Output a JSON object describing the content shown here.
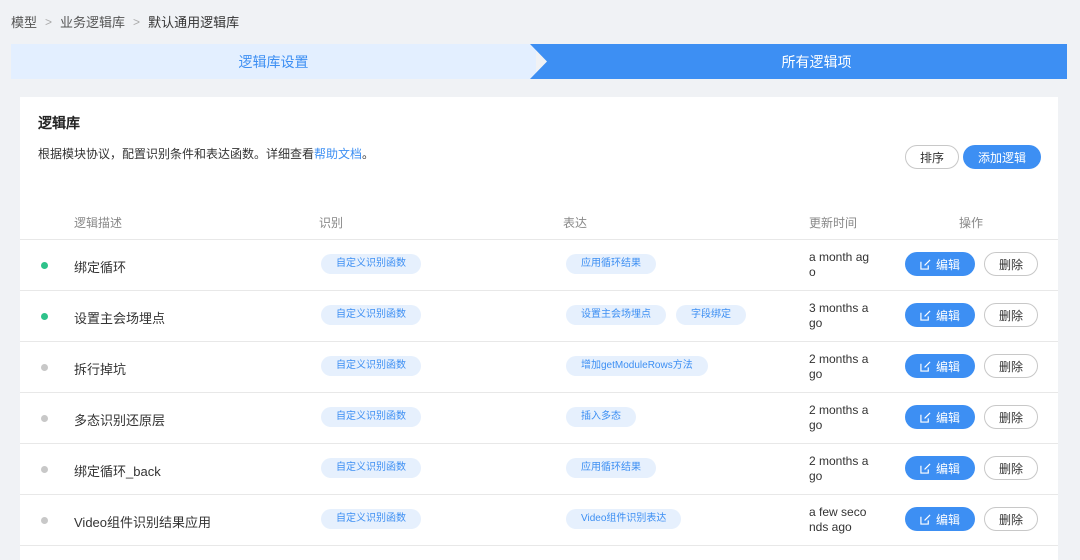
{
  "breadcrumb": [
    "模型",
    "业务逻辑库",
    "默认通用逻辑库"
  ],
  "steps": {
    "step1": "逻辑库设置",
    "step2": "所有逻辑项"
  },
  "card": {
    "title": "逻辑库",
    "desc_text": "根据模块协议，配置识别条件和表达函数。详细查看",
    "desc_link": "帮助文档",
    "desc_end": "。",
    "sort_label": "排序",
    "add_label": "添加逻辑"
  },
  "table": {
    "headers": {
      "desc": "逻辑描述",
      "recognize": "识别",
      "express": "表达",
      "updated": "更新时间",
      "actions": "操作"
    },
    "edit_label": "编辑",
    "delete_label": "删除",
    "rows": [
      {
        "status": "active",
        "name": "绑定循环",
        "recognize": [
          "自定义识别函数"
        ],
        "express": [
          "应用循环结果"
        ],
        "updated": "a month ago"
      },
      {
        "status": "active",
        "name": "设置主会场埋点",
        "recognize": [
          "自定义识别函数"
        ],
        "express": [
          "设置主会场埋点",
          "字段绑定"
        ],
        "updated": "3 months ago"
      },
      {
        "status": "inactive",
        "name": "拆行掉坑",
        "recognize": [
          "自定义识别函数"
        ],
        "express": [
          "增加getModuleRows方法"
        ],
        "updated": "2 months ago"
      },
      {
        "status": "inactive",
        "name": "多态识别还原层",
        "recognize": [
          "自定义识别函数"
        ],
        "express": [
          "插入多态"
        ],
        "updated": "2 months ago"
      },
      {
        "status": "inactive",
        "name": "绑定循环_back",
        "recognize": [
          "自定义识别函数"
        ],
        "express": [
          "应用循环结果"
        ],
        "updated": "2 months ago"
      },
      {
        "status": "inactive",
        "name": "Video组件识别结果应用",
        "recognize": [
          "自定义识别函数"
        ],
        "express": [
          "Video组件识别表达"
        ],
        "updated": "a few seconds ago"
      }
    ]
  },
  "colors": {
    "accent": "#3d8ff3",
    "active": "#2ec28a",
    "inactive": "#c8c8c8",
    "tag_bg": "#e6f0fd"
  }
}
